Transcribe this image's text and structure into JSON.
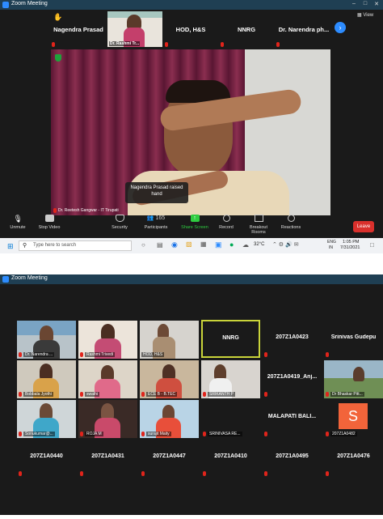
{
  "top_window": {
    "title": "Zoom Meeting",
    "view_label": "View",
    "strip": {
      "name_tiles": [
        "Nagendra Prasad",
        "HOD, H&S",
        "NNRG",
        "Dr. Narendra ph..."
      ],
      "video_tile_label": "Dr. Rashmi Tr..."
    },
    "speaker_label": "Dr. Reetesh Gangwar - IT Tirupati",
    "raise_hand_toast": "Nagendra Prasad raised hand",
    "toolbar": {
      "unmute": "Unmute",
      "stop_video": "Stop Video",
      "security": "Security",
      "participants": "Participants",
      "participants_count": "165",
      "share_screen": "Share Screen",
      "record": "Record",
      "breakout_rooms": "Breakout Rooms",
      "reactions": "Reactions",
      "leave": "Leave"
    }
  },
  "taskbar": {
    "search_placeholder": "Type here to search",
    "temperature": "32°C",
    "language": "ENG",
    "region": "IN",
    "time": "1:05 PM",
    "date": "7/31/2021"
  },
  "bottom_window": {
    "title": "Zoom Meeting",
    "grid": [
      [
        "Dr. Narendra ...",
        "Rashmi Trivedi",
        "HOD, H&S",
        "NNRG",
        "207Z1A0423",
        "Srinivas Gudepu"
      ],
      [
        "Bobbala Jyothi",
        "swathi",
        "ECE B - B.TEC",
        "SRIKANTH P",
        "207Z1A0419_Anj...",
        "Dr Bhaskar Pitt..."
      ],
      [
        "Sonukumar@...",
        "ROJA M",
        "surajit Maity",
        "SRINIVASA RE...",
        "MALAPATI BALI...",
        "207Z1A0482"
      ],
      [
        "207Z1A0440",
        "207Z1A0431",
        "207Z1A0447",
        "207Z1A0410",
        "207Z1A0495",
        "207Z1A0476"
      ]
    ],
    "avatar_letter": "S",
    "colors": {
      "active_border": "#c9d43a",
      "avatar_bg": "#f2643a",
      "leave": "#d9302c"
    }
  }
}
